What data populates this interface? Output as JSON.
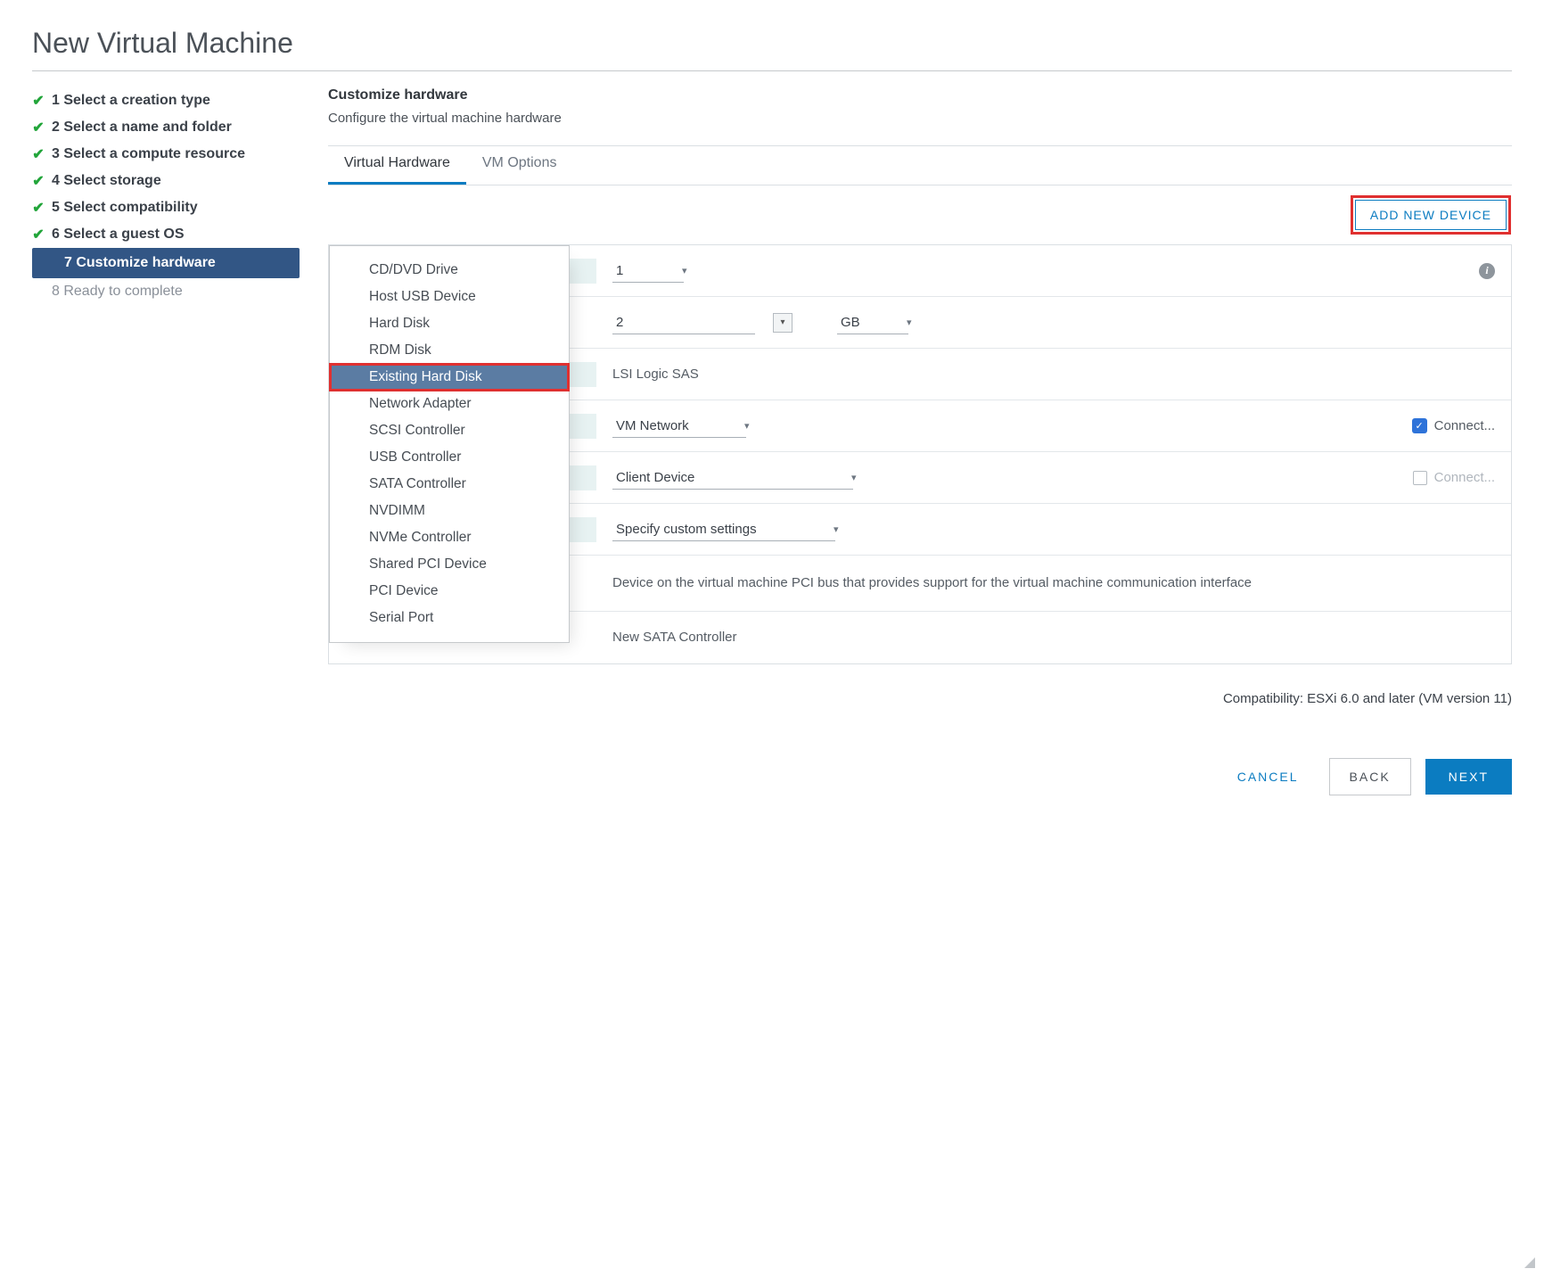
{
  "title": "New Virtual Machine",
  "steps": [
    {
      "label": "1 Select a creation type",
      "state": "done"
    },
    {
      "label": "2 Select a name and folder",
      "state": "done"
    },
    {
      "label": "3 Select a compute resource",
      "state": "done"
    },
    {
      "label": "4 Select storage",
      "state": "done"
    },
    {
      "label": "5 Select compatibility",
      "state": "done"
    },
    {
      "label": "6 Select a guest OS",
      "state": "done"
    },
    {
      "label": "7 Customize hardware",
      "state": "active"
    },
    {
      "label": "8 Ready to complete",
      "state": "future"
    }
  ],
  "main": {
    "heading": "Customize hardware",
    "subheading": "Configure the virtual machine hardware"
  },
  "tabs": [
    {
      "label": "Virtual Hardware",
      "active": true
    },
    {
      "label": "VM Options",
      "active": false
    }
  ],
  "toolbar": {
    "add_device_label": "ADD NEW DEVICE"
  },
  "device_menu": {
    "items": [
      "CD/DVD Drive",
      "Host USB Device",
      "Hard Disk",
      "RDM Disk",
      "Existing Hard Disk",
      "Network Adapter",
      "SCSI Controller",
      "USB Controller",
      "SATA Controller",
      "NVDIMM",
      "NVMe Controller",
      "Shared PCI Device",
      "PCI Device",
      "Serial Port"
    ],
    "selected_index": 4
  },
  "hw": {
    "cpu_value": "1",
    "mem_value": "2",
    "mem_unit": "GB",
    "scsi_value": "LSI Logic SAS",
    "net_value": "VM Network",
    "net_connect_label": "Connect...",
    "cd_value": "Client Device",
    "cd_connect_label": "Connect...",
    "video_value": "Specify custom settings",
    "vmci_desc": "Device on the virtual machine PCI bus that provides support for the virtual machine communication interface",
    "sata_label": "New SATA Controller",
    "sata_value": "New SATA Controller"
  },
  "compat": "Compatibility: ESXi 6.0 and later (VM version 11)",
  "footer": {
    "cancel": "CANCEL",
    "back": "BACK",
    "next": "NEXT"
  }
}
